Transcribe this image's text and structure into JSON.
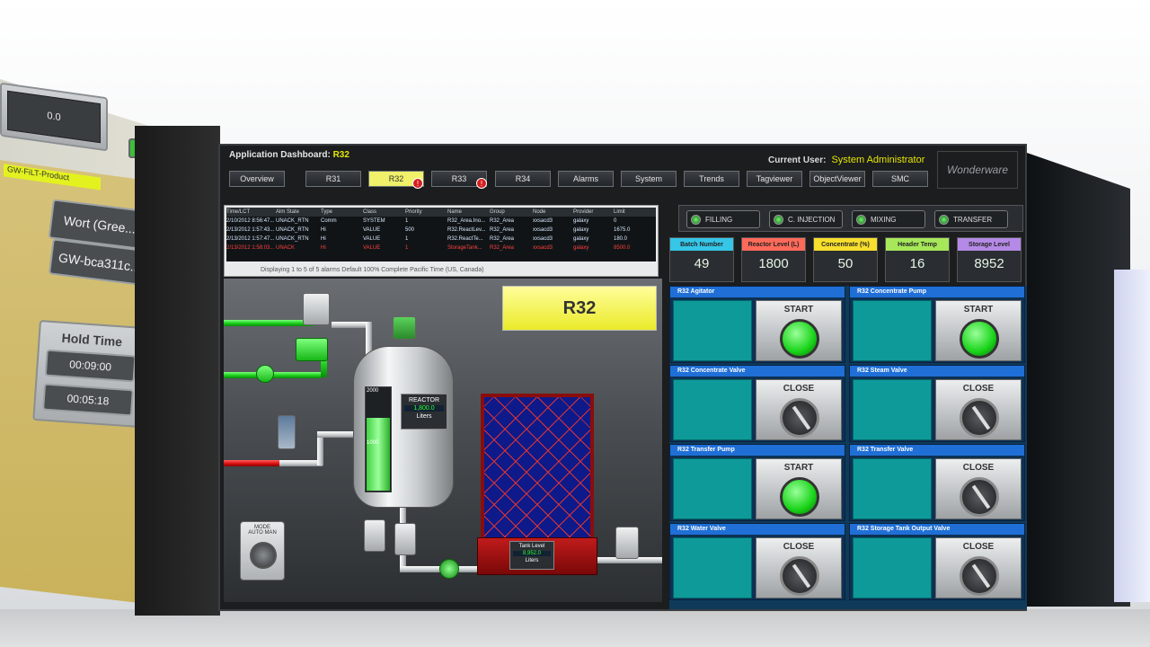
{
  "left_panel": {
    "field_top": "0.0",
    "chip": "GW-FiLT-Product",
    "wort_button": "Wort (Gree...",
    "gw_button": "GW-bca311c...",
    "hold_time_label": "Hold Time",
    "hold_time_1": "00:09:00",
    "hold_time_2": "00:05:18"
  },
  "window": {
    "title_prefix": "Application Dashboard:",
    "title_unit": "R32",
    "current_user_label": "Current User:",
    "current_user": "System Administrator",
    "brand": "Wonderware"
  },
  "tabs": [
    {
      "label": "Overview"
    },
    {
      "label": "R31"
    },
    {
      "label": "R32",
      "badge": "!"
    },
    {
      "label": "R33",
      "badge": "!"
    },
    {
      "label": "R34"
    },
    {
      "label": "Alarms"
    },
    {
      "label": "System"
    },
    {
      "label": "Trends"
    },
    {
      "label": "Tagviewer"
    },
    {
      "label": "ObjectViewer"
    },
    {
      "label": "SMC"
    }
  ],
  "alarm_table": {
    "headers": [
      "Time/LCT",
      "Alm State",
      "Type",
      "Class",
      "Priority",
      "Name",
      "Group",
      "Node",
      "Provider",
      "Limit"
    ],
    "rows": [
      [
        "2/10/2012 8:56:47...",
        "UNACK_RTN",
        "Comm",
        "SYSTEM",
        "1",
        "R32_Area.Ino...",
        "R32_Area",
        "xxsacd3",
        "galaxy",
        "0"
      ],
      [
        "2/13/2012 1:57:43...",
        "UNACK_RTN",
        "Hi",
        "VALUE",
        "500",
        "R32.ReactLev...",
        "R32_Area",
        "xxsacd3",
        "galaxy",
        "1675.0"
      ],
      [
        "2/13/2012 1:57:47...",
        "UNACK_RTN",
        "Hi",
        "VALUE",
        "1",
        "R32.ReactTe...",
        "R32_Area",
        "xxsacd3",
        "galaxy",
        "180.0"
      ],
      [
        "2/13/2012 1:58:03...",
        "UNACK",
        "Hi",
        "VALUE",
        "1",
        "StorageTank...",
        "R32_Area",
        "xxsacd3",
        "galaxy",
        "8500.0"
      ]
    ],
    "row_colors": [
      "#d9e9ff",
      "#d9e9ff",
      "#d9e9ff",
      "#ff4040"
    ],
    "status": "Displaying 1 to 5 of 5 alarms   Default   100% Complete   Pacific Time (US, Canada)"
  },
  "process": {
    "unit_label": "R32",
    "reactor_title": "REACTOR",
    "reactor_value": "1,800.0",
    "reactor_unit": "Liters",
    "reactor_scale_top": "2000",
    "reactor_scale_mid": "1000",
    "reactor_fill_fraction": 0.7,
    "storage_title": "Tank Level",
    "storage_value": "8,952.0",
    "storage_unit": "Liters",
    "mode_title": "MODE",
    "mode_auto": "AUTO",
    "mode_man": "MAN"
  },
  "states": [
    {
      "label": "FILLING"
    },
    {
      "label": "C. INJECTION"
    },
    {
      "label": "MIXING"
    },
    {
      "label": "TRANSFER"
    }
  ],
  "kpis": [
    {
      "label": "Batch Number",
      "value": "49",
      "color": "#35c6e8"
    },
    {
      "label": "Reactor Level (L)",
      "value": "1800",
      "color": "#ff6a5a"
    },
    {
      "label": "Concentrate (%)",
      "value": "50",
      "color": "#f7df2d"
    },
    {
      "label": "Header Temp",
      "value": "16",
      "color": "#a7e85a"
    },
    {
      "label": "Storage Level",
      "value": "8952",
      "color": "#b48ae6"
    }
  ],
  "faceplates": [
    {
      "title": "R32 Agitator",
      "control": "START",
      "kind": "start"
    },
    {
      "title": "R32 Concentrate Pump",
      "control": "START",
      "kind": "start"
    },
    {
      "title": "R32 Concentrate Valve",
      "control": "CLOSE",
      "kind": "close"
    },
    {
      "title": "R32 Steam Valve",
      "control": "CLOSE",
      "kind": "close"
    },
    {
      "title": "R32 Transfer Pump",
      "control": "START",
      "kind": "start"
    },
    {
      "title": "R32 Transfer Valve",
      "control": "CLOSE",
      "kind": "close"
    },
    {
      "title": "R32 Water Valve",
      "control": "CLOSE",
      "kind": "close"
    },
    {
      "title": "R32 Storage Tank Output Valve",
      "control": "CLOSE",
      "kind": "close"
    }
  ]
}
